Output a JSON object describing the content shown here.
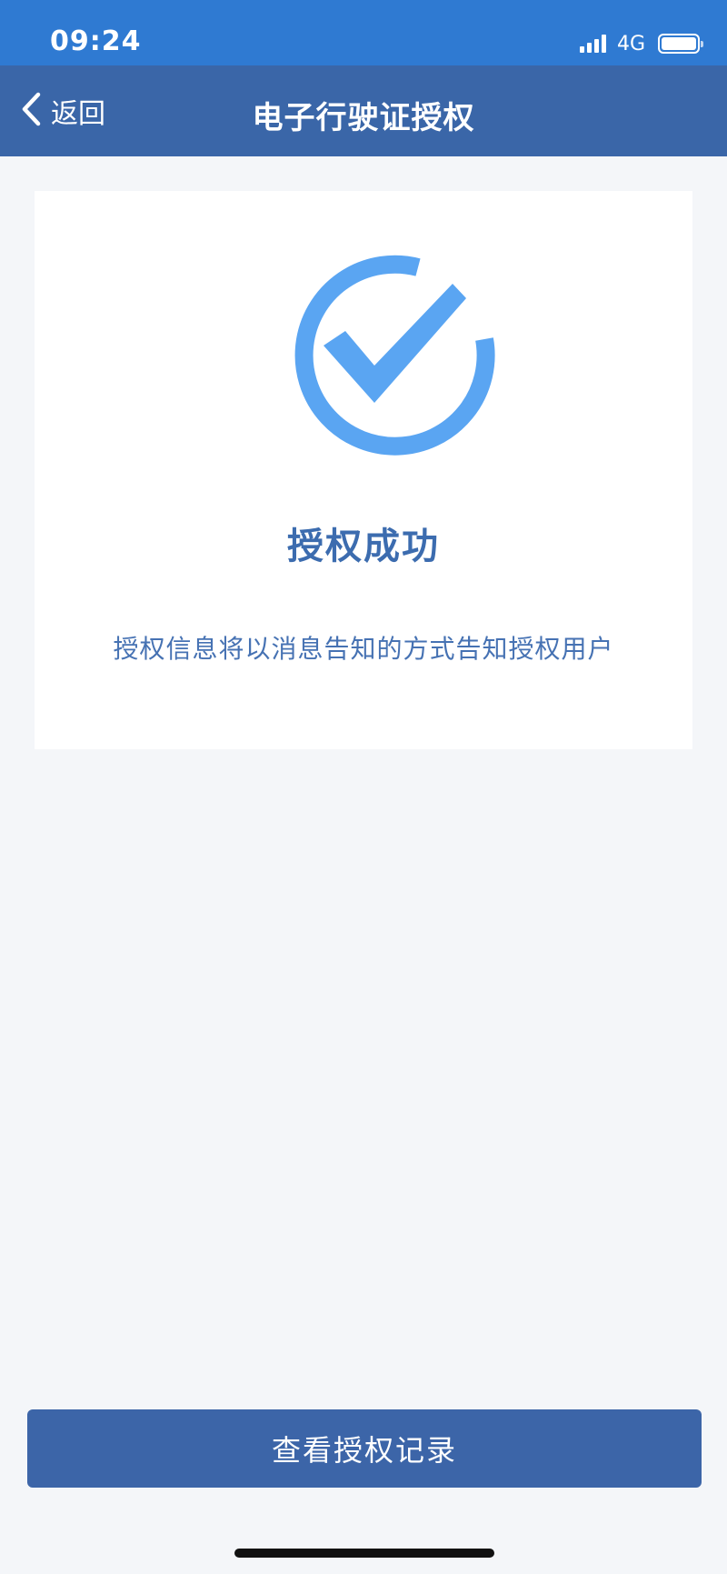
{
  "status_bar": {
    "time": "09:24",
    "network": "4G",
    "signal_bars": 4,
    "battery_level": 1.0
  },
  "nav": {
    "back_label": "返回",
    "title": "电子行驶证授权"
  },
  "result": {
    "icon": "check-circle-icon",
    "title": "授权成功",
    "description": "授权信息将以消息告知的方式告知授权用户"
  },
  "actions": {
    "view_records_label": "查看授权记录"
  },
  "colors": {
    "status_bar": "#2f7ad2",
    "nav_bar": "#3a66a8",
    "accent": "#5aa5f2",
    "title_text": "#3c6caf",
    "button": "#3c65a8",
    "page_background": "#f4f6f9"
  }
}
